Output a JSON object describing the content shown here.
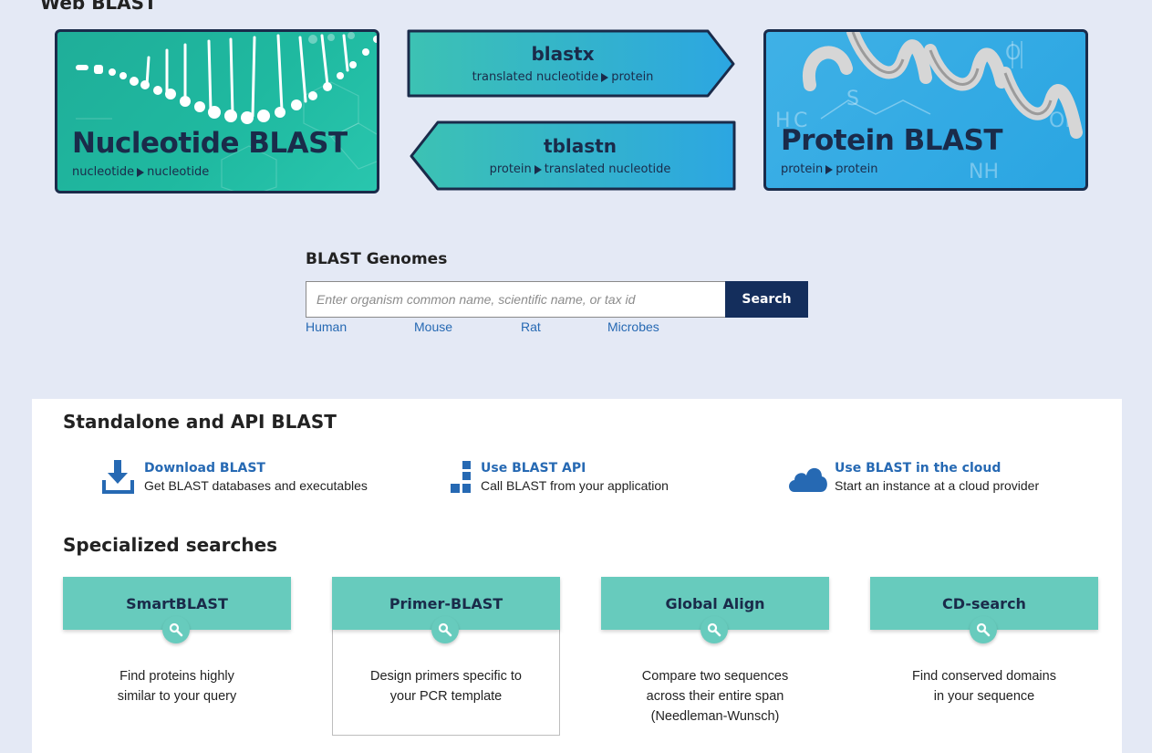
{
  "page": {
    "heading": "Web BLAST"
  },
  "tiles": {
    "nucleotide": {
      "title": "Nucleotide BLAST",
      "from": "nucleotide",
      "to": "nucleotide"
    },
    "protein": {
      "title": "Protein BLAST",
      "from": "protein",
      "to": "protein"
    }
  },
  "arrows": {
    "blastx": {
      "name": "blastx",
      "from": "translated nucleotide",
      "to": "protein"
    },
    "tblastn": {
      "name": "tblastn",
      "from": "protein",
      "to": "translated nucleotide"
    }
  },
  "genomes": {
    "title": "BLAST Genomes",
    "placeholder": "Enter organism common name, scientific name, or tax id",
    "search_label": "Search",
    "links": [
      "Human",
      "Mouse",
      "Rat",
      "Microbes"
    ]
  },
  "standalone": {
    "title": "Standalone and API BLAST",
    "items": [
      {
        "link": "Download BLAST",
        "desc": "Get BLAST databases and executables",
        "icon": "download-icon"
      },
      {
        "link": "Use BLAST API",
        "desc": "Call BLAST from your application",
        "icon": "api-blocks-icon"
      },
      {
        "link": "Use BLAST in the cloud",
        "desc": "Start an instance at a cloud provider",
        "icon": "cloud-icon"
      }
    ]
  },
  "specialized": {
    "title": "Specialized searches",
    "cards": [
      {
        "title": "SmartBLAST",
        "desc_lines": [
          "Find proteins highly",
          "similar to your query"
        ]
      },
      {
        "title": "Primer-BLAST",
        "desc_lines": [
          "Design primers specific to",
          "your PCR template"
        ]
      },
      {
        "title": "Global Align",
        "desc_lines": [
          "Compare two sequences",
          "across their entire span",
          "(Needleman-Wunsch)"
        ]
      },
      {
        "title": "CD-search",
        "desc_lines": [
          "Find conserved domains",
          "in your sequence"
        ]
      }
    ]
  },
  "colors": {
    "background": "#e4e9f5",
    "navy": "#1a2b4a",
    "teal": "#67cbbd",
    "link": "#2669b3",
    "search_button": "#142e5c"
  }
}
